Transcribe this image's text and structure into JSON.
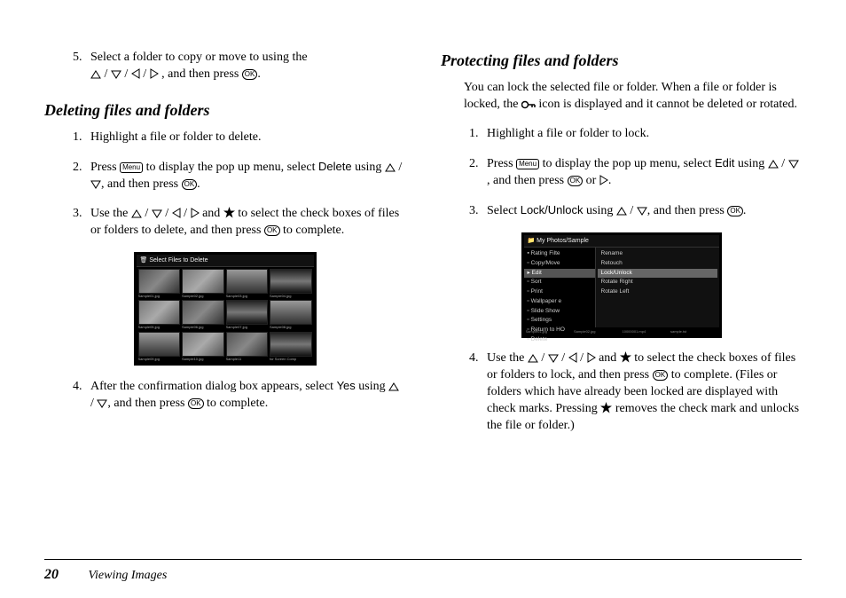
{
  "page_number": "20",
  "footer_title": "Viewing Images",
  "left": {
    "step5_a": "Select a folder to copy or move to using the ",
    "step5_b": ", and then press ",
    "section_delete": "Deleting files and folders",
    "d1": "Highlight a file or folder to delete.",
    "d2_a": "Press ",
    "d2_b": " to display the pop up menu, select ",
    "d2_delete": "Delete",
    "d2_c": " using ",
    "d2_d": ", and then press ",
    "d3_a": "Use the ",
    "d3_b": " and ",
    "d3_c": " to select the check boxes of files or folders to delete, and then press ",
    "d3_d": " to complete.",
    "d4_a": "After the confirmation dialog box appears, select ",
    "d4_yes": "Yes",
    "d4_b": " using ",
    "d4_c": ", and then press ",
    "d4_d": " to complete.",
    "ss1_title": "Select Files to Delete"
  },
  "right": {
    "section_protect": "Protecting files and folders",
    "intro_a": "You can lock the selected file or folder. When a file or folder is locked, the ",
    "intro_b": " icon is displayed and it cannot be deleted or rotated.",
    "p1": "Highlight a file or folder to lock.",
    "p2_a": "Press ",
    "p2_b": " to display the pop up menu, select ",
    "p2_edit": "Edit",
    "p2_c": " using ",
    "p2_d": ", and then press ",
    "p2_e": " or ",
    "p3_a": "Select ",
    "p3_lock": "Lock/Unlock",
    "p3_b": " using ",
    "p3_c": ", and then press ",
    "p4_a": "Use the ",
    "p4_b": " and ",
    "p4_c": " to select the check boxes of files or folders to lock, and then press ",
    "p4_d": " to complete. (Files or folders which have already been locked are displayed with check marks. Pressing ",
    "p4_e": " removes the check mark and unlocks the file or folder.)",
    "ss2_title": "My Photos/Sample",
    "ss2_menu": [
      "▪ Rating Filte",
      "▫ Copy/Move",
      "▸ Edit",
      "▫ Sort",
      "▫ Print",
      "▫ Wallpaper e",
      "▫ Slide Show",
      "▫ Settings",
      "▫ Return to HO",
      "▫ Delete"
    ],
    "ss2_sub": [
      "Rename",
      "Retouch",
      "Lock/Unlock",
      "Rotate Right",
      "Rotate Left"
    ]
  },
  "icons": {
    "menu_label": "Menu",
    "ok_label": "OK"
  }
}
